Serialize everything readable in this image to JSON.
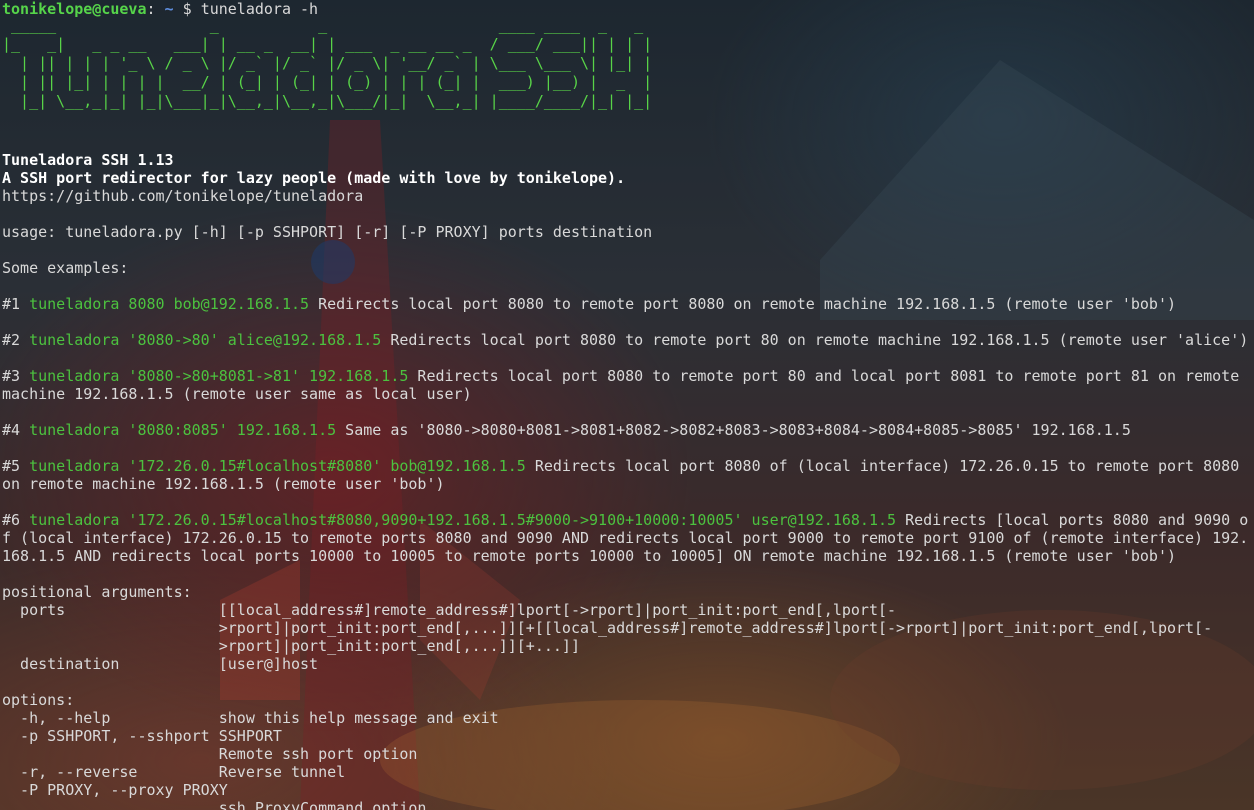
{
  "prompt": {
    "user_host": "tonikelope@cueva",
    "separator": ":",
    "path": " ~",
    "symbol": " $ ",
    "command": "tuneladora -h"
  },
  "banner": {
    "lines": [
      " _____                 _           _                   ____ ____  _   _ ",
      "|_   _|   _ _ __   ___| | __ _  __| | ___  _ __ __ _  / ___/ ___|| | | |",
      "  | || | | | '_ \\ / _ \\ |/ _` |/ _` |/ _ \\| '__/ _` | \\___ \\___ \\| |_| |",
      "  | || |_| | | | |  __/ | (_| | (_| | (_) | | | (_| |  ___) |__) |  _  |",
      "  |_| \\__,_|_| |_|\\___|_|\\__,_|\\__,_|\\___/|_|  \\__,_| |____/____/|_| |_|"
    ]
  },
  "header": {
    "title": "Tuneladora SSH 1.13",
    "tagline": "A SSH port redirector for lazy people (made with love by tonikelope).",
    "url": "https://github.com/tonikelope/tuneladora"
  },
  "usage": "usage: tuneladora.py [-h] [-p SSHPORT] [-r] [-P PROXY] ports destination",
  "examples_heading": "Some examples:",
  "examples": [
    {
      "num": "#1 ",
      "cmd": "tuneladora 8080 bob@192.168.1.5",
      "desc": " Redirects local port 8080 to remote port 8080 on remote machine 192.168.1.5 (remote user 'bob')"
    },
    {
      "num": "#2 ",
      "cmd": "tuneladora '8080->80' alice@192.168.1.5",
      "desc": " Redirects local port 8080 to remote port 80 on remote machine 192.168.1.5 (remote user 'alice')"
    },
    {
      "num": "#3 ",
      "cmd": "tuneladora '8080->80+8081->81' 192.168.1.5",
      "desc": " Redirects local port 8080 to remote port 80 and local port 8081 to remote port 81 on remote machine 192.168.1.5 (remote user same as local user)"
    },
    {
      "num": "#4 ",
      "cmd": "tuneladora '8080:8085' 192.168.1.5",
      "desc": " Same as '8080->8080+8081->8081+8082->8082+8083->8083+8084->8084+8085->8085' 192.168.1.5"
    },
    {
      "num": "#5 ",
      "cmd": "tuneladora '172.26.0.15#localhost#8080' bob@192.168.1.5",
      "desc": " Redirects local port 8080 of (local interface) 172.26.0.15 to remote port 8080 on remote machine 192.168.1.5 (remote user 'bob')"
    },
    {
      "num": "#6 ",
      "cmd": "tuneladora '172.26.0.15#localhost#8080,9090+192.168.1.5#9000->9100+10000:10005' user@192.168.1.5",
      "desc": " Redirects [local ports 8080 and 9090 of (local interface) 172.26.0.15 to remote ports 8080 and 9090 AND redirects local port 9000 to remote port 9100 of (remote interface) 192.168.1.5 AND redirects local ports 10000 to 10005 to remote ports 10000 to 10005] ON remote machine 192.168.1.5 (remote user 'bob')"
    }
  ],
  "positional": {
    "heading": "positional arguments:",
    "lines": [
      "  ports                 [[local_address#]remote_address#]lport[->rport]|port_init:port_end[,lport[-",
      "                        >rport]|port_init:port_end[,...]][+[[local_address#]remote_address#]lport[->rport]|port_init:port_end[,lport[-",
      "                        >rport]|port_init:port_end[,...]][+...]]",
      "  destination           [user@]host"
    ]
  },
  "options": {
    "heading": "options:",
    "lines": [
      "  -h, --help            show this help message and exit",
      "  -p SSHPORT, --sshport SSHPORT",
      "                        Remote ssh port option",
      "  -r, --reverse         Reverse tunnel",
      "  -P PROXY, --proxy PROXY",
      "                        ssh ProxyCommand option"
    ]
  },
  "colors": {
    "prompt_user": "#56d44a",
    "prompt_path": "#5f8fe0",
    "banner": "#58d348",
    "example_cmd": "#4cc23f",
    "text": "#d9d9d9"
  }
}
